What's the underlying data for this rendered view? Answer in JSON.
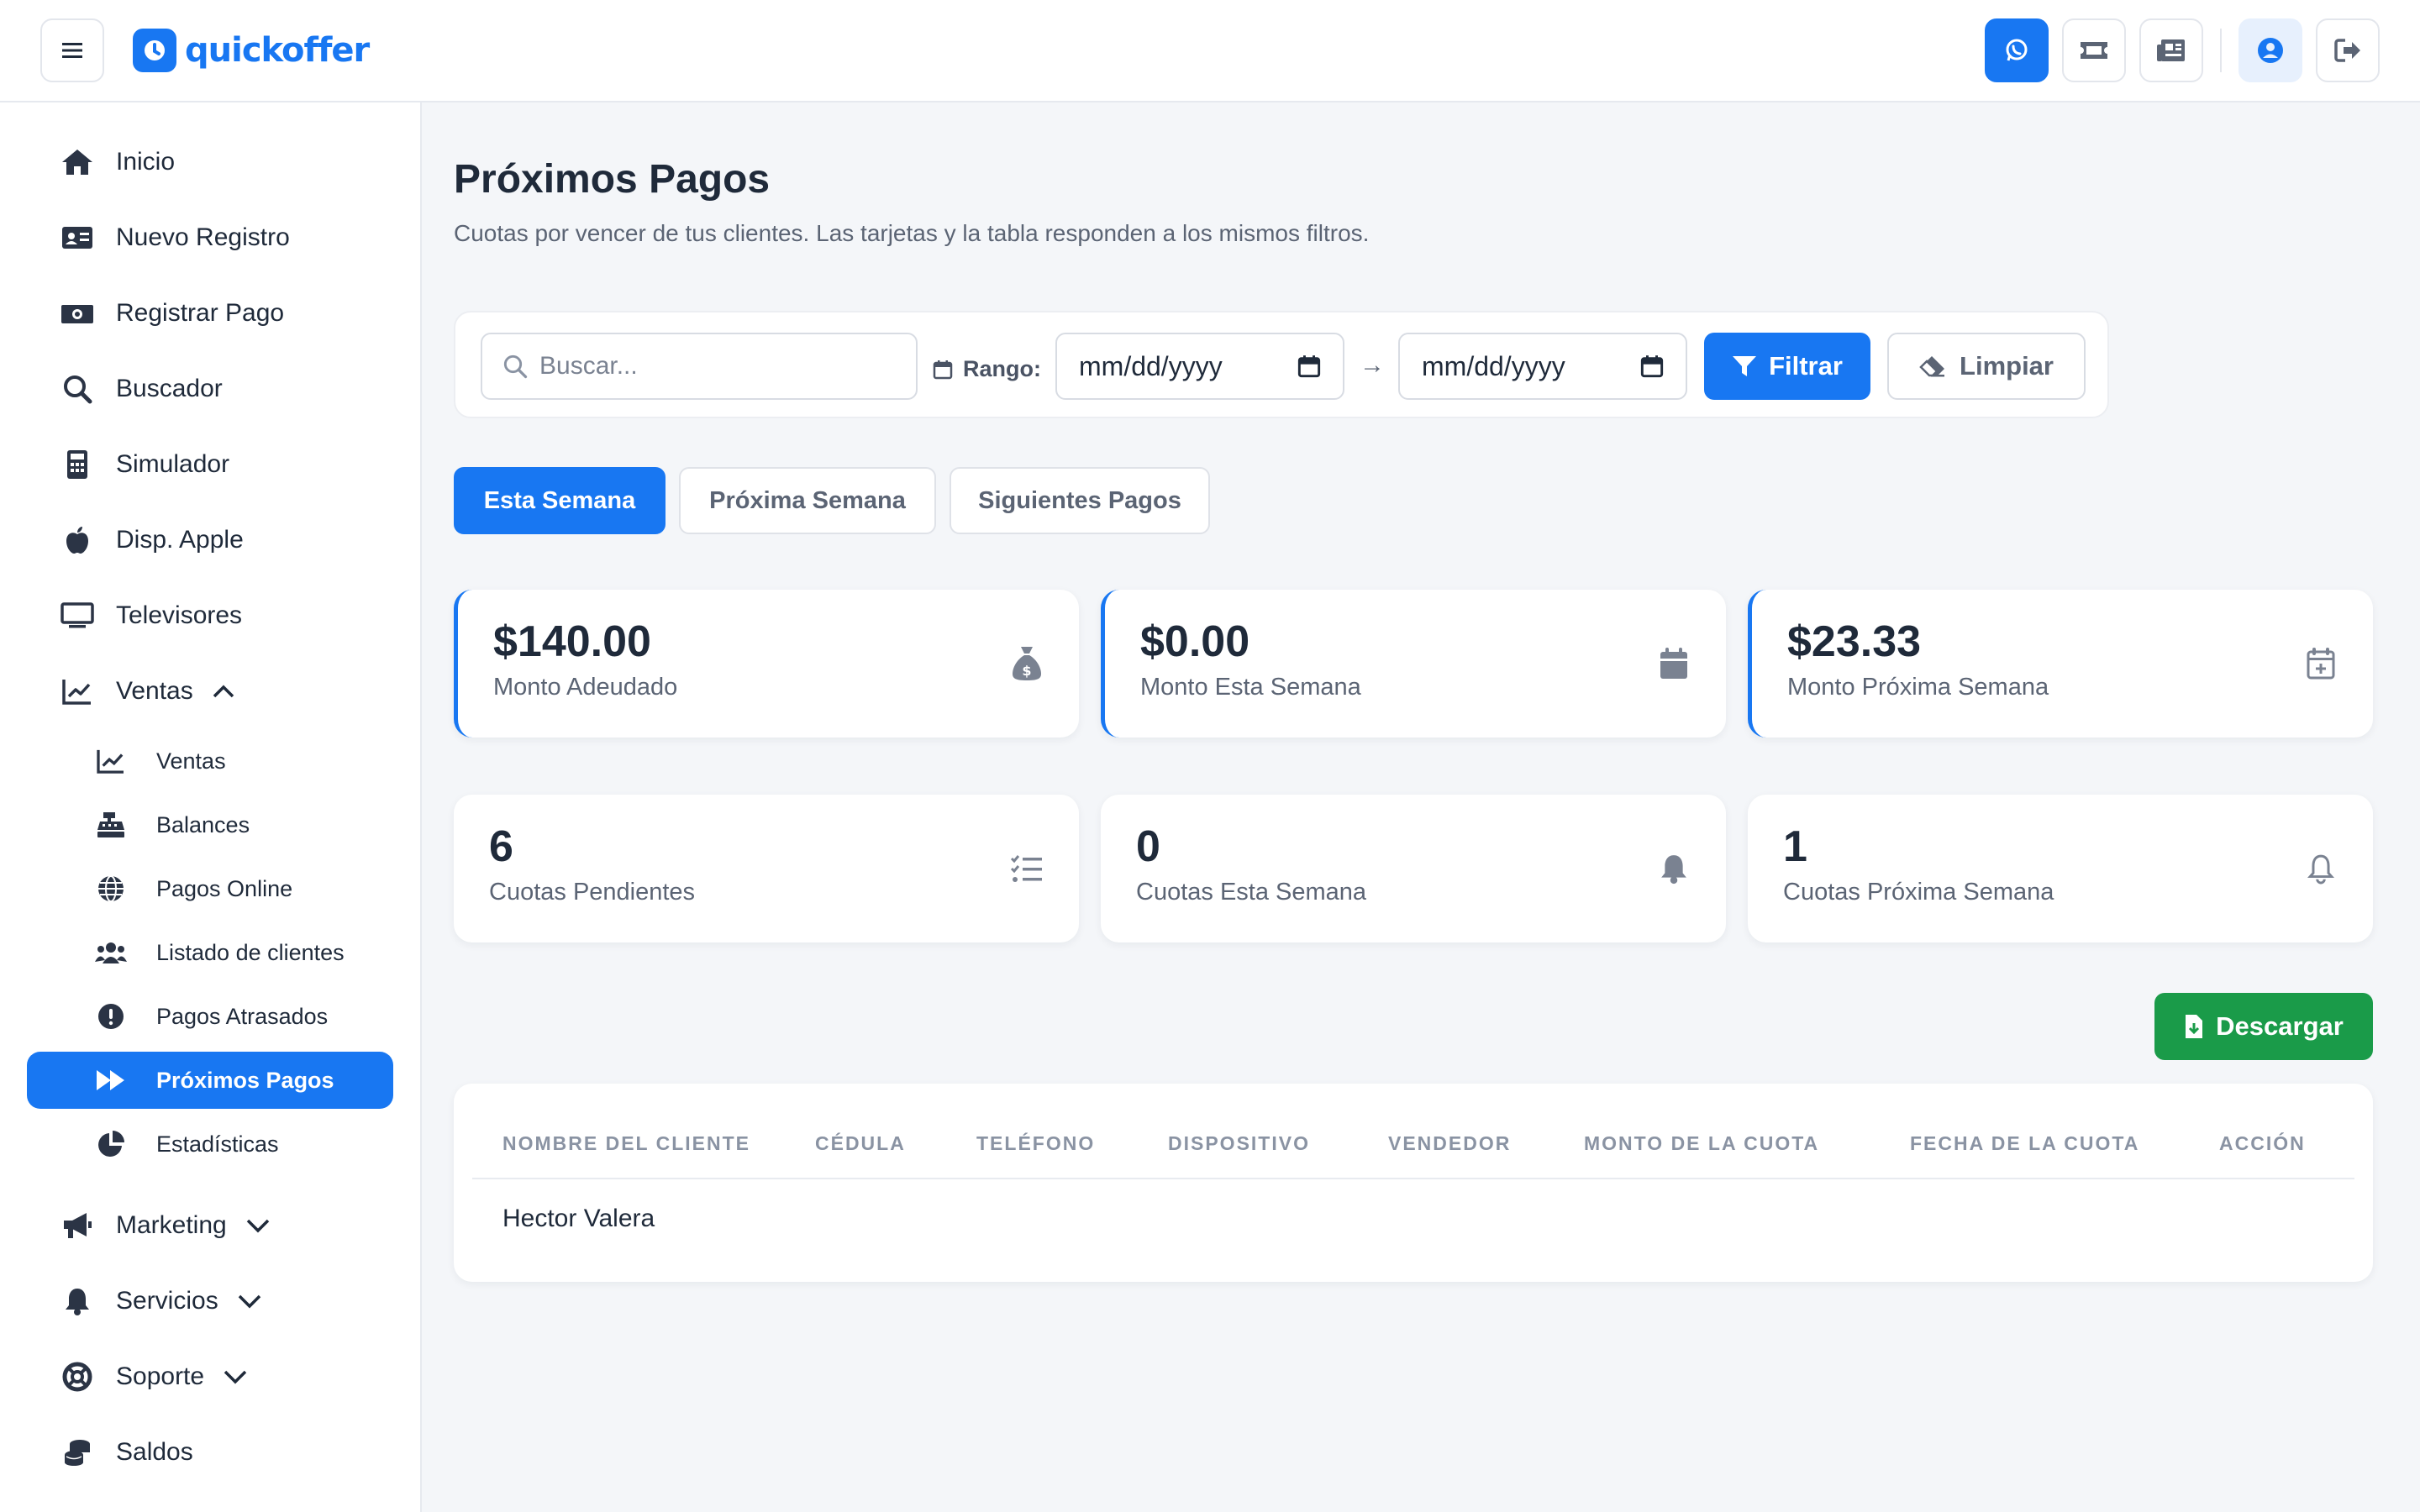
{
  "app": {
    "logo_text": "quickoffer",
    "brand_color": "#1877f2"
  },
  "topbar": {
    "icons": [
      "whatsapp-icon",
      "ticket-icon",
      "newspaper-icon",
      "user-circle-icon",
      "logout-icon"
    ]
  },
  "sidebar": {
    "items": [
      {
        "label": "Inicio",
        "icon": "home-icon"
      },
      {
        "label": "Nuevo Registro",
        "icon": "id-card-icon"
      },
      {
        "label": "Registrar Pago",
        "icon": "money-icon"
      },
      {
        "label": "Buscador",
        "icon": "search-icon"
      },
      {
        "label": "Simulador",
        "icon": "calculator-icon"
      },
      {
        "label": "Disp. Apple",
        "icon": "apple-icon"
      },
      {
        "label": "Televisores",
        "icon": "tv-icon"
      },
      {
        "label": "Ventas",
        "icon": "chart-line-icon"
      }
    ],
    "ventas_sub": [
      {
        "label": "Ventas",
        "icon": "chart-line-icon"
      },
      {
        "label": "Balances",
        "icon": "cash-register-icon"
      },
      {
        "label": "Pagos Online",
        "icon": "globe-icon"
      },
      {
        "label": "Listado de clientes",
        "icon": "users-icon"
      },
      {
        "label": "Pagos Atrasados",
        "icon": "exclamation-icon"
      },
      {
        "label": "Próximos Pagos",
        "icon": "fast-forward-icon"
      },
      {
        "label": "Estadísticas",
        "icon": "pie-chart-icon"
      }
    ],
    "bottom": [
      {
        "label": "Marketing",
        "icon": "megaphone-icon"
      },
      {
        "label": "Servicios",
        "icon": "bell-icon"
      },
      {
        "label": "Soporte",
        "icon": "lifebuoy-icon"
      },
      {
        "label": "Saldos",
        "icon": "coins-icon"
      }
    ]
  },
  "main": {
    "title": "Próximos Pagos",
    "subtitle": "Cuotas por vencer de tus clientes. Las tarjetas y la tabla responden a los mismos filtros.",
    "filters": {
      "search_placeholder": "Buscar...",
      "range_label": "Rango:",
      "date_from": "mm/dd/yyyy",
      "date_to": "mm/dd/yyyy",
      "arrow": "→",
      "filter_button": "Filtrar",
      "clear_button": "Limpiar"
    },
    "tabs": [
      "Esta Semana",
      "Próxima Semana",
      "Siguientes Pagos"
    ],
    "stats": [
      {
        "value": "$140.00",
        "label": "Monto Adeudado",
        "icon": "money-bag-icon"
      },
      {
        "value": "$0.00",
        "label": "Monto Esta Semana",
        "icon": "calendar-icon"
      },
      {
        "value": "$23.33",
        "label": "Monto Próxima Semana",
        "icon": "calendar-plus-icon"
      },
      {
        "value": "6",
        "label": "Cuotas Pendientes",
        "icon": "list-check-icon"
      },
      {
        "value": "0",
        "label": "Cuotas Esta Semana",
        "icon": "bell-icon"
      },
      {
        "value": "1",
        "label": "Cuotas Próxima Semana",
        "icon": "bell-outline-icon"
      }
    ],
    "download_button": "Descargar",
    "table": {
      "headers": [
        "NOMBRE DEL CLIENTE",
        "CÉDULA",
        "TELÉFONO",
        "DISPOSITIVO",
        "VENDEDOR",
        "MONTO DE LA CUOTA",
        "FECHA DE LA CUOTA",
        "ACCIÓN"
      ],
      "rows": [
        [
          "Hector Valera",
          "",
          "",
          "",
          "",
          "",
          "",
          ""
        ]
      ]
    }
  }
}
